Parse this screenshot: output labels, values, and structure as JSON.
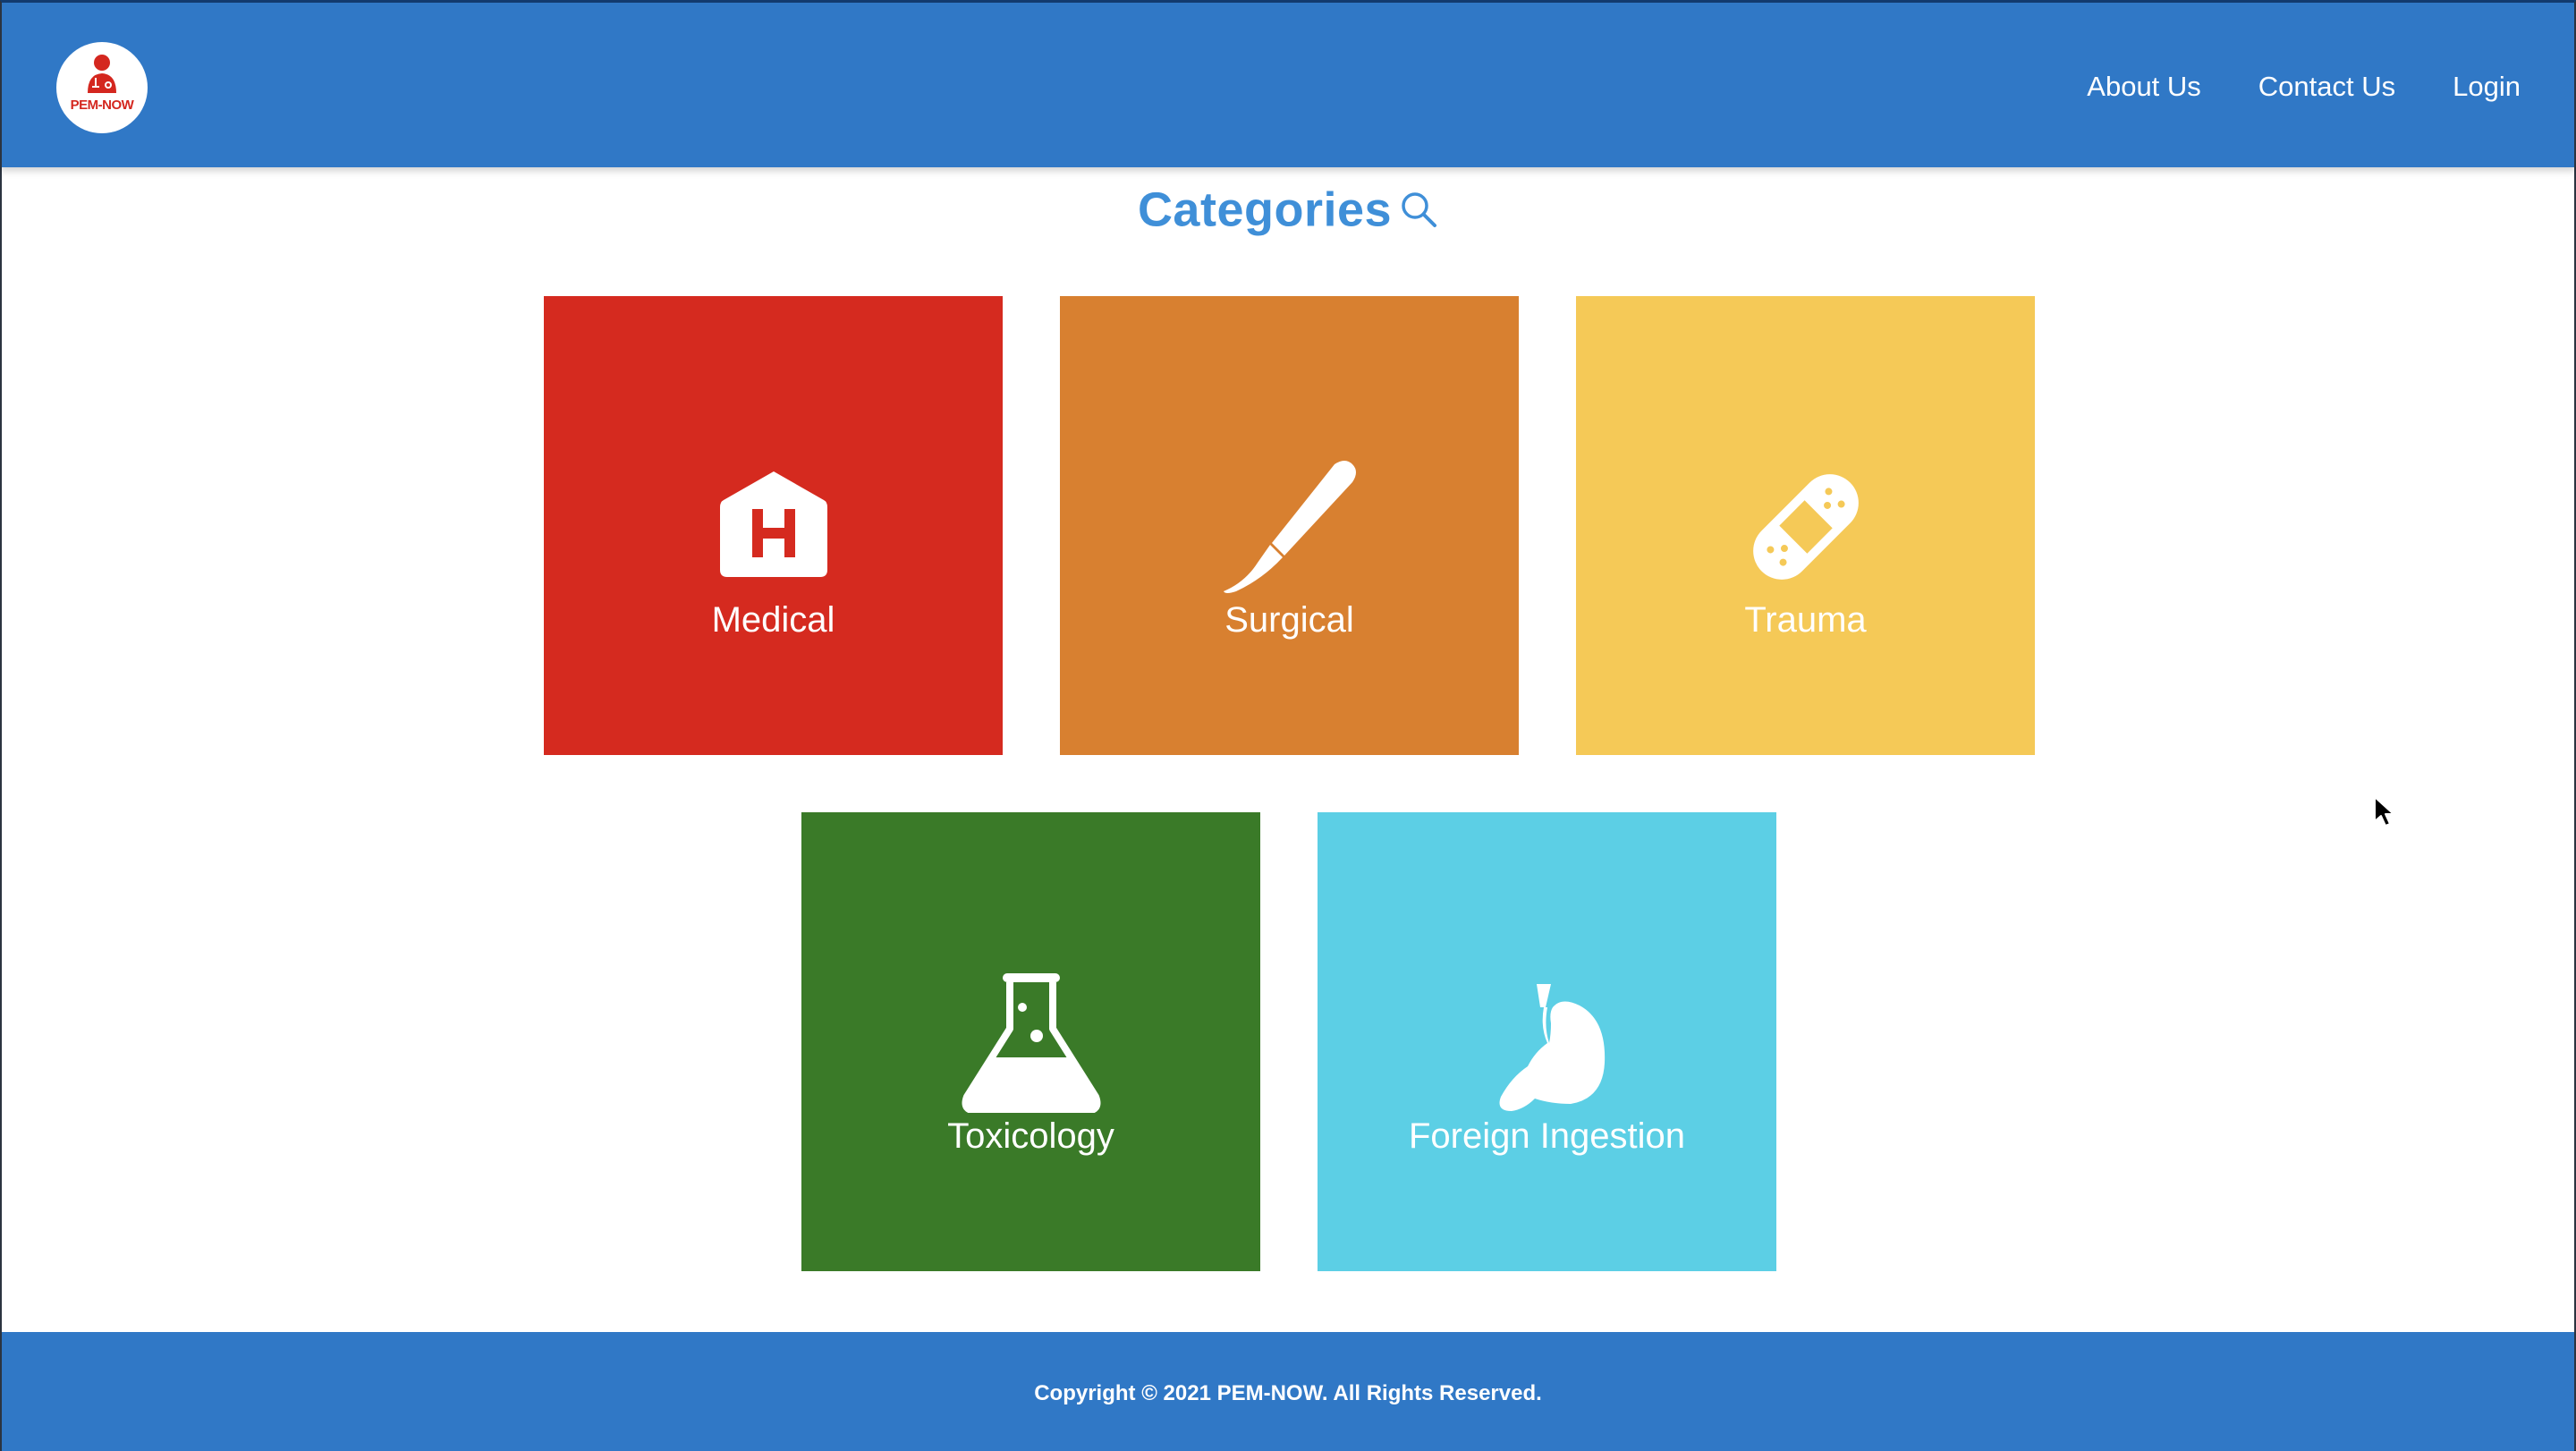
{
  "colors": {
    "header_bg": "#3078c6",
    "footer_bg": "#3078c6",
    "title_color": "#3f8fd8",
    "logo_red": "#d4271f",
    "tile_medical": "#d52a1f",
    "tile_surgical": "#d88030",
    "tile_trauma": "#f5c957",
    "tile_toxicology": "#3a7a28",
    "tile_foreign": "#5ccfe5"
  },
  "header": {
    "logo": {
      "text": "PEM-NOW",
      "icon": "doctor-icon"
    },
    "nav": [
      {
        "label": "About Us"
      },
      {
        "label": "Contact Us"
      },
      {
        "label": "Login"
      }
    ]
  },
  "main": {
    "title": "Categories",
    "search_icon": "search-icon",
    "categories": [
      {
        "label": "Medical",
        "icon": "hospital-icon"
      },
      {
        "label": "Surgical",
        "icon": "scalpel-icon"
      },
      {
        "label": "Trauma",
        "icon": "bandage-icon"
      },
      {
        "label": "Toxicology",
        "icon": "flask-icon"
      },
      {
        "label": "Foreign Ingestion",
        "icon": "stomach-icon"
      }
    ]
  },
  "footer": {
    "copyright": "Copyright © 2021 PEM-NOW. All Rights Reserved."
  }
}
